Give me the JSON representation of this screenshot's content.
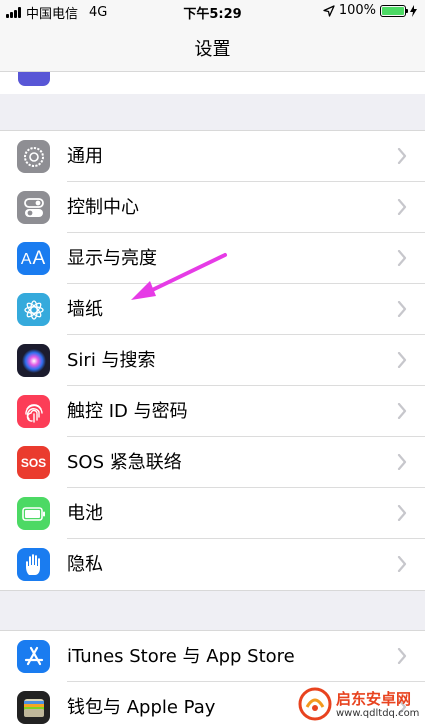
{
  "status_bar": {
    "carrier": "中国电信",
    "network": "4G",
    "time": "下午5:29",
    "battery_percent": "100%",
    "battery_level": 1.0
  },
  "nav": {
    "title": "设置"
  },
  "group1": {
    "items": [
      {
        "label": "通用",
        "icon": "gear-icon",
        "color": "#8e8e93"
      },
      {
        "label": "控制中心",
        "icon": "toggles-icon",
        "color": "#8e8e93"
      },
      {
        "label": "显示与亮度",
        "icon": "text-size-icon",
        "color": "#1a7cf0"
      },
      {
        "label": "墙纸",
        "icon": "flower-icon",
        "color": "#35aadc"
      },
      {
        "label": "Siri 与搜索",
        "icon": "siri-icon",
        "color": "#1c1c2e"
      },
      {
        "label": "触控 ID 与密码",
        "icon": "fingerprint-icon",
        "color": "#fc3d57"
      },
      {
        "label": "SOS 紧急联络",
        "icon": "sos-icon",
        "color": "#ea3b2e"
      },
      {
        "label": "电池",
        "icon": "battery-icon",
        "color": "#4cd964"
      },
      {
        "label": "隐私",
        "icon": "hand-icon",
        "color": "#1a7cf0"
      }
    ]
  },
  "group2": {
    "items": [
      {
        "label": "iTunes Store 与 App Store",
        "icon": "app-store-icon",
        "color": "#1a7cf0"
      },
      {
        "label": "钱包与 Apple Pay",
        "icon": "wallet-icon",
        "color": "#222222"
      }
    ]
  },
  "sos_text": "SOS",
  "watermark": {
    "title": "启东安卓网",
    "url": "www.qdltdq.com"
  },
  "colors": {
    "annotation_arrow": "#e63be6",
    "chevron": "#c7c7cc"
  }
}
